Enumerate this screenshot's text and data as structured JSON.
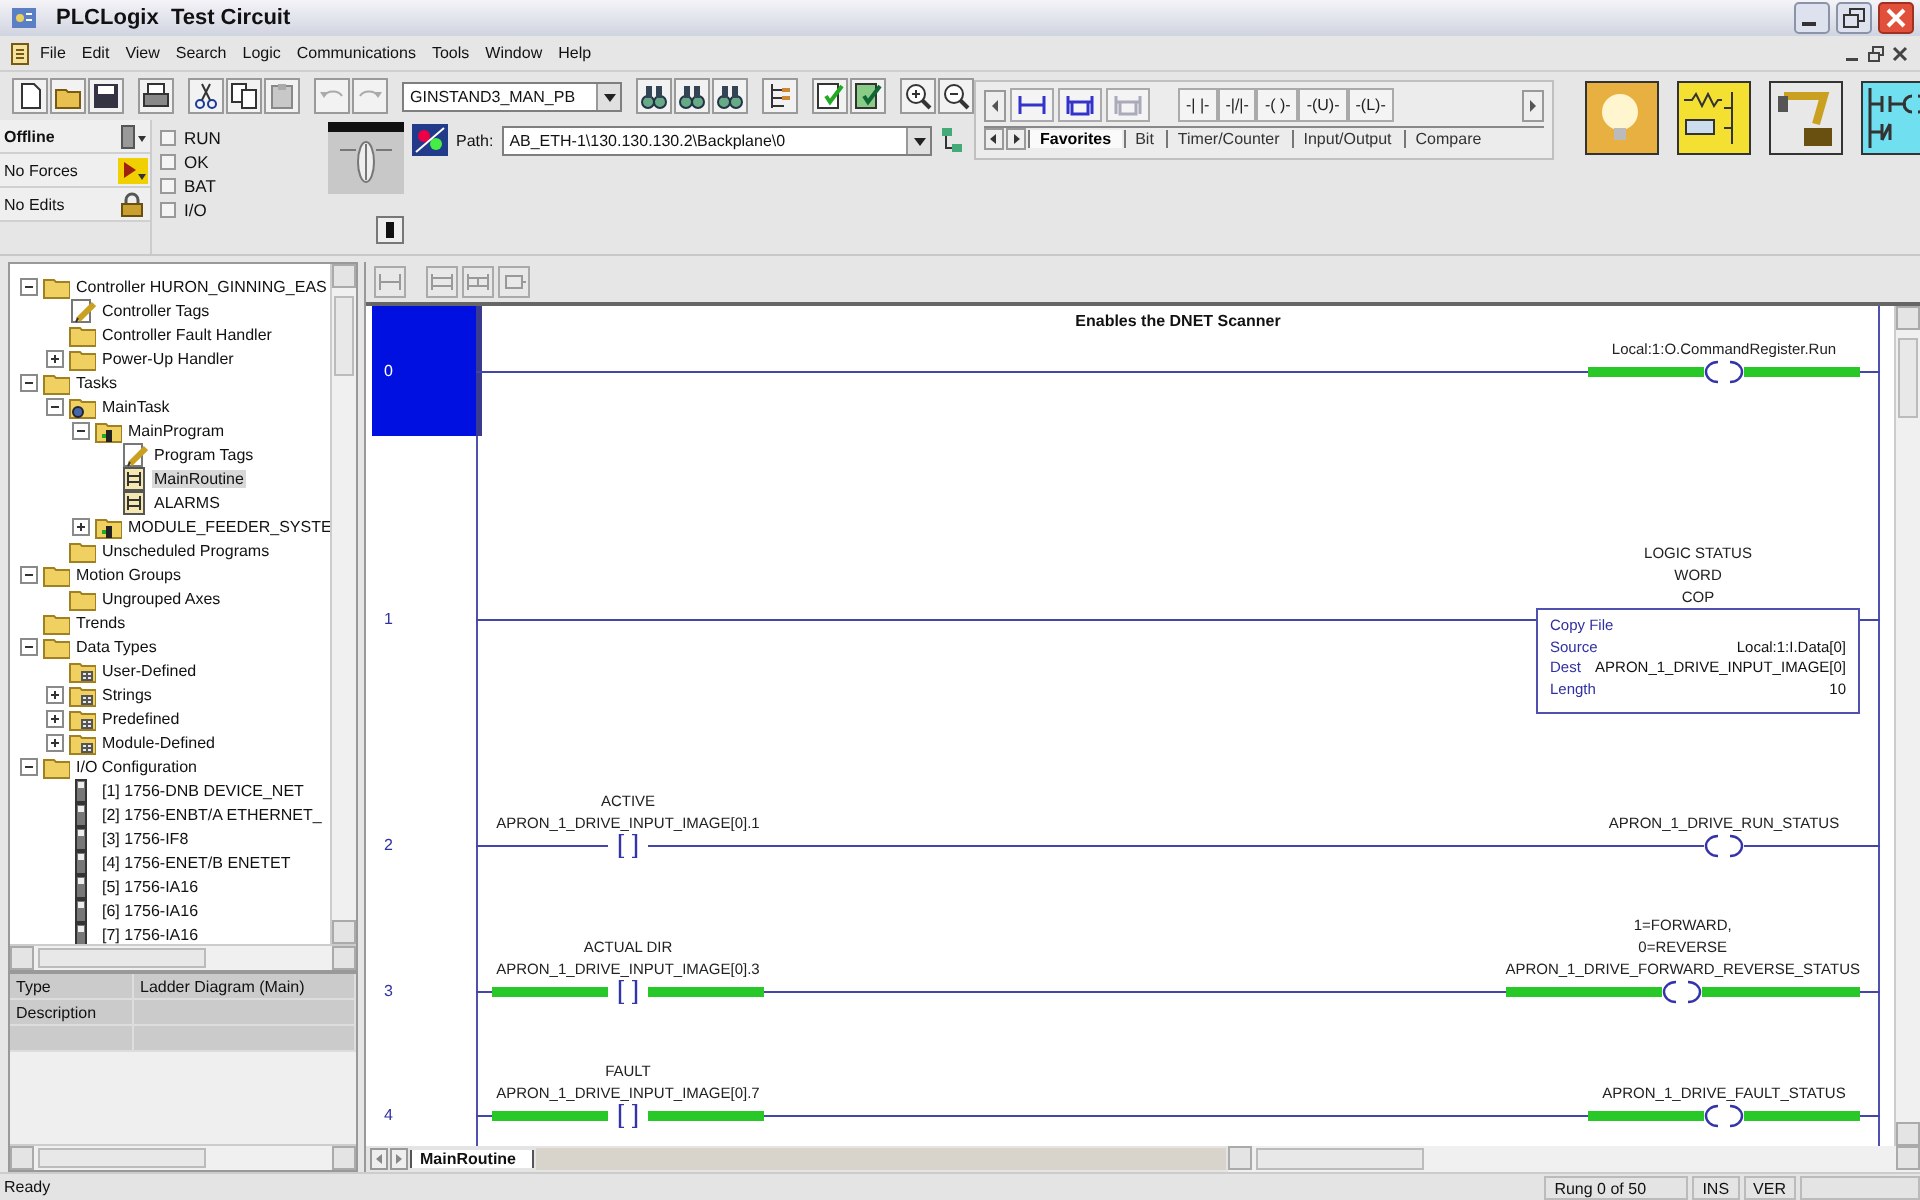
{
  "window": {
    "title": "PLCLogix  Test Circuit"
  },
  "menu": [
    "File",
    "Edit",
    "View",
    "Search",
    "Logic",
    "Communications",
    "Tools",
    "Window",
    "Help"
  ],
  "toolbar": {
    "routine_combo": "GINSTAND3_MAN_PB"
  },
  "controller_status": {
    "mode": "Offline",
    "forces": "No Forces",
    "edits": "No Edits",
    "indicators": [
      {
        "label": "RUN",
        "checked": false
      },
      {
        "label": "OK",
        "checked": false
      },
      {
        "label": "BAT",
        "checked": false
      },
      {
        "label": "I/O",
        "checked": false
      }
    ]
  },
  "path": {
    "label": "Path:",
    "value": "AB_ETH-1\\130.130.130.2\\Backplane\\0"
  },
  "palette": {
    "instructions": [
      "-| |-",
      "-|/|-",
      "-( )-",
      "-(U)-",
      "-(L)-"
    ],
    "tabs": [
      {
        "label": "Favorites",
        "selected": true
      },
      {
        "label": "Bit",
        "selected": false
      },
      {
        "label": "Timer/Counter",
        "selected": false
      },
      {
        "label": "Input/Output",
        "selected": false
      },
      {
        "label": "Compare",
        "selected": false
      }
    ]
  },
  "tree": [
    {
      "label": "Controller HURON_GINNING_EAS",
      "kind": "folder",
      "expanded": true,
      "selected": false,
      "children": [
        {
          "label": "Controller Tags",
          "kind": "tags",
          "selected": false
        },
        {
          "label": "Controller Fault Handler",
          "kind": "folder",
          "selected": false
        },
        {
          "label": "Power-Up Handler",
          "kind": "folder",
          "expanded": false,
          "selected": false
        }
      ]
    },
    {
      "label": "Tasks",
      "kind": "folder",
      "expanded": true,
      "selected": false,
      "children": [
        {
          "label": "MainTask",
          "kind": "task",
          "expanded": true,
          "selected": false,
          "children": [
            {
              "label": "MainProgram",
              "kind": "program",
              "expanded": true,
              "selected": false,
              "children": [
                {
                  "label": "Program Tags",
                  "kind": "tags",
                  "selected": false
                },
                {
                  "label": "MainRoutine",
                  "kind": "routine",
                  "selected": true
                },
                {
                  "label": "ALARMS",
                  "kind": "routine",
                  "selected": false
                }
              ]
            },
            {
              "label": "MODULE_FEEDER_SYSTE",
              "kind": "program",
              "expanded": false,
              "selected": false
            }
          ]
        },
        {
          "label": "Unscheduled Programs",
          "kind": "folder",
          "selected": false
        }
      ]
    },
    {
      "label": "Motion Groups",
      "kind": "folder",
      "expanded": true,
      "selected": false,
      "children": [
        {
          "label": "Ungrouped Axes",
          "kind": "folder",
          "selected": false
        }
      ]
    },
    {
      "label": "Trends",
      "kind": "folder",
      "selected": false
    },
    {
      "label": "Data Types",
      "kind": "folder",
      "expanded": true,
      "selected": false,
      "children": [
        {
          "label": "User-Defined",
          "kind": "datatype",
          "selected": false
        },
        {
          "label": "Strings",
          "kind": "datatype",
          "expanded": false,
          "selected": false
        },
        {
          "label": "Predefined",
          "kind": "datatype",
          "expanded": false,
          "selected": false
        },
        {
          "label": "Module-Defined",
          "kind": "datatype",
          "expanded": false,
          "selected": false
        }
      ]
    },
    {
      "label": "I/O Configuration",
      "kind": "folder",
      "expanded": true,
      "selected": false,
      "children": [
        {
          "label": "[1] 1756-DNB DEVICE_NET",
          "kind": "module",
          "selected": false
        },
        {
          "label": "[2] 1756-ENBT/A ETHERNET_",
          "kind": "module",
          "selected": false
        },
        {
          "label": "[3] 1756-IF8",
          "kind": "module",
          "selected": false
        },
        {
          "label": "[4] 1756-ENET/B ENETET",
          "kind": "module",
          "selected": false
        },
        {
          "label": "[5] 1756-IA16",
          "kind": "module",
          "selected": false
        },
        {
          "label": "[6] 1756-IA16",
          "kind": "module",
          "selected": false
        },
        {
          "label": "[7] 1756-IA16",
          "kind": "module",
          "selected": false
        }
      ]
    }
  ],
  "properties": [
    {
      "label": "Type",
      "value": "Ladder Diagram (Main)"
    },
    {
      "label": "Description"
    }
  ],
  "ladder": {
    "rungs": [
      {
        "number": "0",
        "selected": true,
        "comment": "Enables the DNET Scanner",
        "outputs": [
          {
            "kind": "coil",
            "tag": "Local:1:O.CommandRegister.Run",
            "energized": true
          }
        ]
      },
      {
        "number": "1",
        "selected": false,
        "outputs": [
          {
            "kind": "cop",
            "descriptions": [
              "LOGIC STATUS",
              "WORD"
            ],
            "mnemonic": "COP",
            "title": "Copy File",
            "energized": false,
            "operands": [
              {
                "label": "Source",
                "value": "Local:1:I.Data[0]"
              },
              {
                "label": "Dest",
                "value": "APRON_1_DRIVE_INPUT_IMAGE[0]"
              },
              {
                "label": "Length",
                "value": "10"
              }
            ]
          }
        ]
      },
      {
        "number": "2",
        "selected": false,
        "inputs": [
          {
            "kind": "contact",
            "descriptions": [
              "ACTIVE"
            ],
            "tag": "APRON_1_DRIVE_INPUT_IMAGE[0].1",
            "energized": false
          }
        ],
        "outputs": [
          {
            "kind": "coil",
            "tag": "APRON_1_DRIVE_RUN_STATUS",
            "energized": false
          }
        ]
      },
      {
        "number": "3",
        "selected": false,
        "inputs": [
          {
            "kind": "contact",
            "descriptions": [
              "ACTUAL DIR"
            ],
            "tag": "APRON_1_DRIVE_INPUT_IMAGE[0].3",
            "energized": true
          }
        ],
        "outputs": [
          {
            "kind": "coil",
            "descriptions": [
              "1=FORWARD,",
              "0=REVERSE"
            ],
            "tag": "APRON_1_DRIVE_FORWARD_REVERSE_STATUS",
            "energized": true
          }
        ]
      },
      {
        "number": "4",
        "selected": false,
        "inputs": [
          {
            "kind": "contact",
            "descriptions": [
              "FAULT"
            ],
            "tag": "APRON_1_DRIVE_INPUT_IMAGE[0].7",
            "energized": true
          }
        ],
        "outputs": [
          {
            "kind": "coil",
            "tag": "APRON_1_DRIVE_FAULT_STATUS",
            "energized": true
          }
        ]
      }
    ]
  },
  "routine_tabs": [
    {
      "label": "MainRoutine",
      "selected": true
    }
  ],
  "status_bar": {
    "message": "Ready",
    "rung": "Rung 0 of 50",
    "insert_mode": "INS",
    "verify": "VER"
  }
}
